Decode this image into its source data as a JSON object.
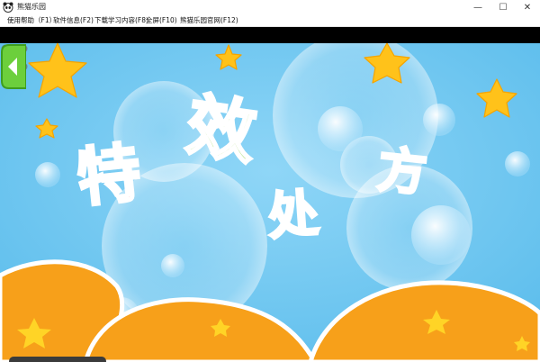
{
  "window": {
    "title": "熊猫乐园",
    "icon": "panda-icon",
    "minimize_glyph": "—",
    "maximize_glyph": "☐",
    "close_glyph": "✕"
  },
  "menu": {
    "items": [
      {
        "label": "使用帮助（F1）"
      },
      {
        "label": "软件信息(F2)"
      },
      {
        "label": "下载学习内容(F8)"
      },
      {
        "label": "全屏(F10)"
      },
      {
        "label": "熊猫乐园官网(F12)"
      }
    ]
  },
  "stage": {
    "chars": [
      {
        "text": "特",
        "color": "#f0505a"
      },
      {
        "text": "效",
        "color": "#8ed04a"
      },
      {
        "text": "处",
        "color": "#2f56d8"
      },
      {
        "text": "方",
        "color": "#f29a1c"
      }
    ],
    "colors": {
      "sky": "#6cc7f2",
      "star": "#ffc21a",
      "ground": "#f7a01a",
      "tab": "#6ccf3c"
    },
    "close_icon": "close-x-icon",
    "side_tab_icon": "chevron-left-icon"
  }
}
